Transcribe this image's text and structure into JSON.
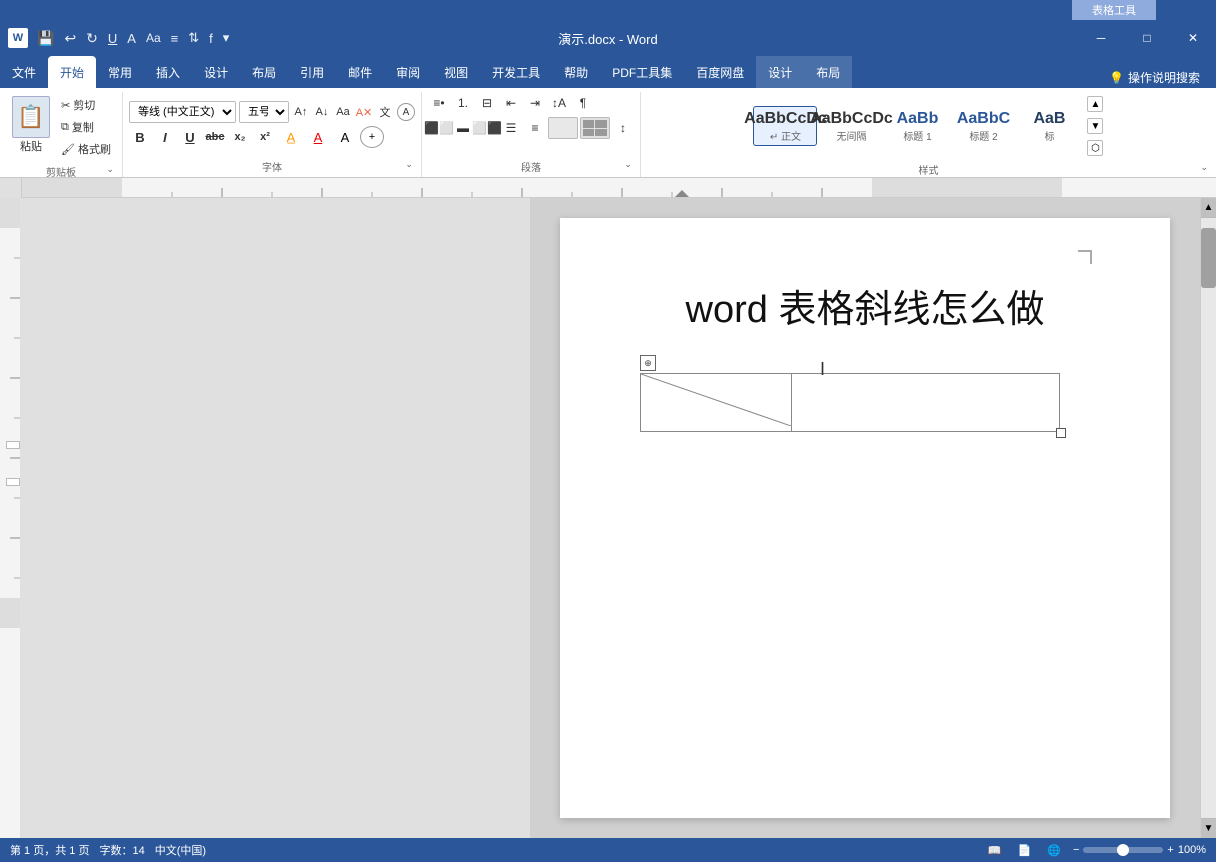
{
  "titleBar": {
    "title": "演示.docx - Word",
    "contextLabel": "表格工具",
    "saveBtn": "💾",
    "undoBtn": "↩",
    "redoBtn": "↻",
    "underlineBtn": "U̲",
    "textBtn": "A",
    "casBtn": "Aa",
    "listBtn": "≡",
    "sortBtn": "⇅",
    "funcBtn": "f",
    "moreBtn": "•"
  },
  "windowControls": {
    "minimize": "─",
    "restore": "□",
    "close": "✕"
  },
  "tabs": [
    {
      "id": "file",
      "label": "文件"
    },
    {
      "id": "home",
      "label": "开始",
      "active": true
    },
    {
      "id": "common",
      "label": "常用"
    },
    {
      "id": "insert",
      "label": "插入"
    },
    {
      "id": "design",
      "label": "设计"
    },
    {
      "id": "layout1",
      "label": "布局"
    },
    {
      "id": "reference",
      "label": "引用"
    },
    {
      "id": "mailing",
      "label": "邮件"
    },
    {
      "id": "review",
      "label": "审阅"
    },
    {
      "id": "view",
      "label": "视图"
    },
    {
      "id": "developer",
      "label": "开发工具"
    },
    {
      "id": "help",
      "label": "帮助"
    },
    {
      "id": "pdf",
      "label": "PDF工具集"
    },
    {
      "id": "baidu",
      "label": "百度网盘"
    },
    {
      "id": "tdesign",
      "label": "设计"
    },
    {
      "id": "tlayout",
      "label": "布局"
    }
  ],
  "helpSearch": {
    "icon": "💡",
    "label": "操作说明搜索"
  },
  "ribbon": {
    "clipboard": {
      "groupLabel": "剪贴板",
      "pasteLabel": "粘贴",
      "cutLabel": "剪切",
      "copyLabel": "复制",
      "formatLabel": "格式刷"
    },
    "font": {
      "groupLabel": "字体",
      "fontName": "等线 (中文正文)",
      "fontSize": "五号",
      "boldLabel": "B",
      "italicLabel": "I",
      "underlineLabel": "U",
      "strikeLabel": "abc",
      "subLabel": "x₂",
      "supLabel": "x²",
      "clearLabel": "A"
    },
    "paragraph": {
      "groupLabel": "段落"
    },
    "styles": {
      "groupLabel": "样式",
      "items": [
        {
          "label": "正文",
          "preview": "AaBbCcDc"
        },
        {
          "label": "无间隔",
          "preview": "AaBbCcDc"
        },
        {
          "label": "标题 1",
          "preview": "AaBb"
        },
        {
          "label": "标题 2",
          "preview": "AaBbC"
        },
        {
          "label": "标",
          "preview": "AaB"
        }
      ]
    }
  },
  "document": {
    "title": "word 表格斜线怎么做",
    "table": {
      "rows": 1,
      "cols": 2,
      "col1Width": 150,
      "col2Width": 270,
      "height": 52
    }
  }
}
